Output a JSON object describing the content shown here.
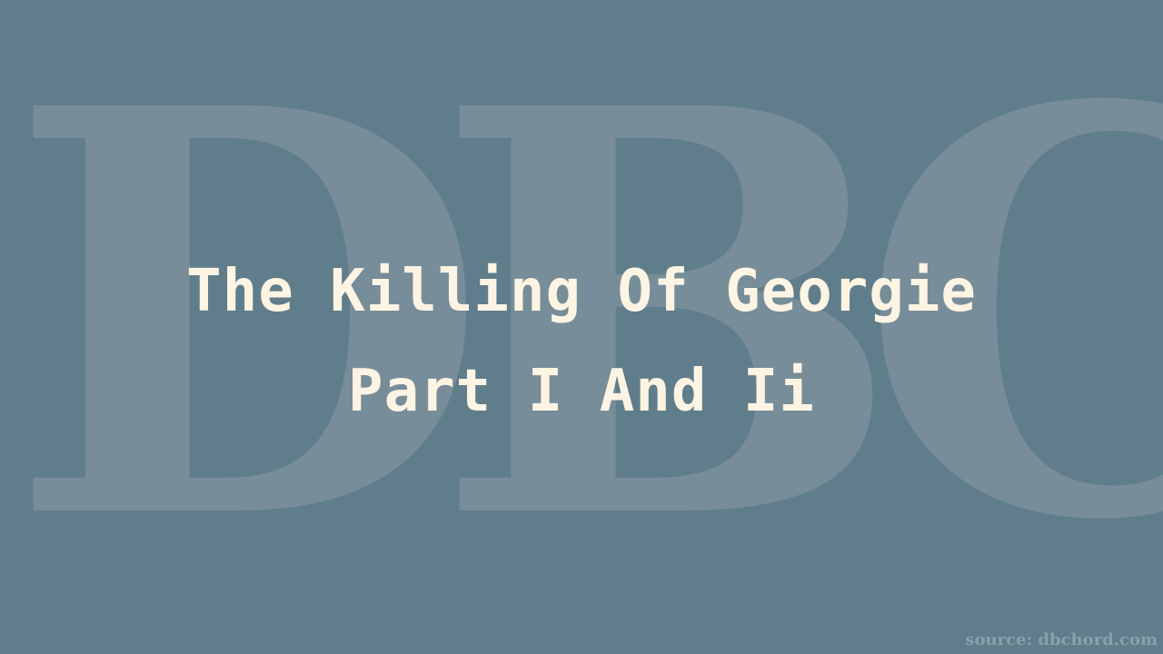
{
  "watermark": {
    "text": "DBC"
  },
  "title": {
    "line1": "The Killing Of Georgie",
    "line2": "Part I And Ii"
  },
  "source": {
    "text": "source: dbchord.com"
  },
  "colors": {
    "background": "#607d8b",
    "watermark": "#778d99",
    "title": "#fdf4e3",
    "source": "#8aa0ab"
  }
}
